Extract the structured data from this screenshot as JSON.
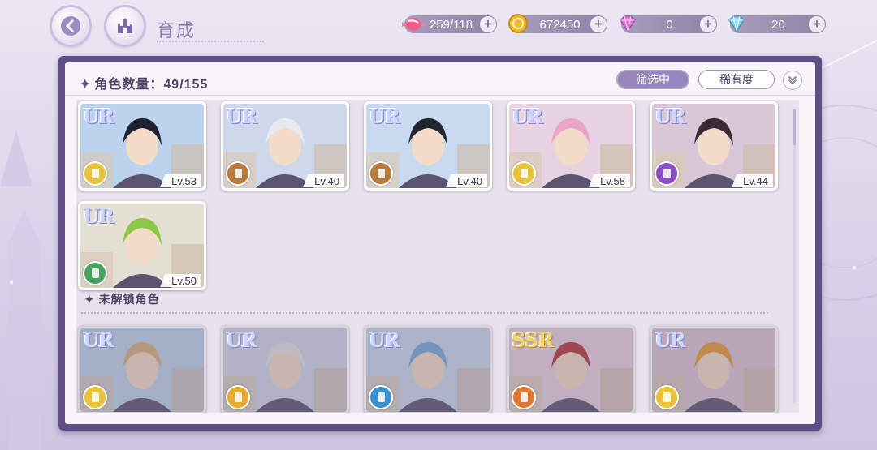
{
  "header": {
    "title": "育成",
    "resources": [
      {
        "name": "candy",
        "value": "259/118",
        "icon": "candy-icon"
      },
      {
        "name": "gold",
        "value": "672450",
        "icon": "coin-icon"
      },
      {
        "name": "gem-pink",
        "value": "0",
        "icon": "pink-diamond-icon"
      },
      {
        "name": "gem-blue",
        "value": "20",
        "icon": "blue-diamond-icon"
      }
    ],
    "plus_symbol": "+"
  },
  "panel": {
    "count_label": "角色数量：49/155",
    "filter_label": "筛选中",
    "rarity_label": "稀有度",
    "locked_section_label": "未解锁角色",
    "star": "✦"
  },
  "owned_cards": [
    {
      "rarity": "UR",
      "level": "Lv.53",
      "element_color": "#e9c43a"
    },
    {
      "rarity": "UR",
      "level": "Lv.40",
      "element_color": "#b57a3c"
    },
    {
      "rarity": "UR",
      "level": "Lv.40",
      "element_color": "#b57a3c"
    },
    {
      "rarity": "UR",
      "level": "Lv.58",
      "element_color": "#e9c43a"
    },
    {
      "rarity": "UR",
      "level": "Lv.44",
      "element_color": "#8e4fc2"
    },
    {
      "rarity": "UR",
      "level": "Lv.50",
      "element_color": "#45a35f"
    }
  ],
  "locked_cards": [
    {
      "rarity": "UR",
      "element_color": "#e9c43a"
    },
    {
      "rarity": "UR",
      "element_color": "#e9a92f"
    },
    {
      "rarity": "UR",
      "element_color": "#3a8fd0"
    },
    {
      "rarity": "SSR",
      "element_color": "#e0782f"
    },
    {
      "rarity": "UR",
      "element_color": "#e9c43a"
    }
  ],
  "colors": {
    "panel_border": "#5f4f86",
    "filter_active": "#9787bc",
    "text_dark": "#4d4466"
  }
}
